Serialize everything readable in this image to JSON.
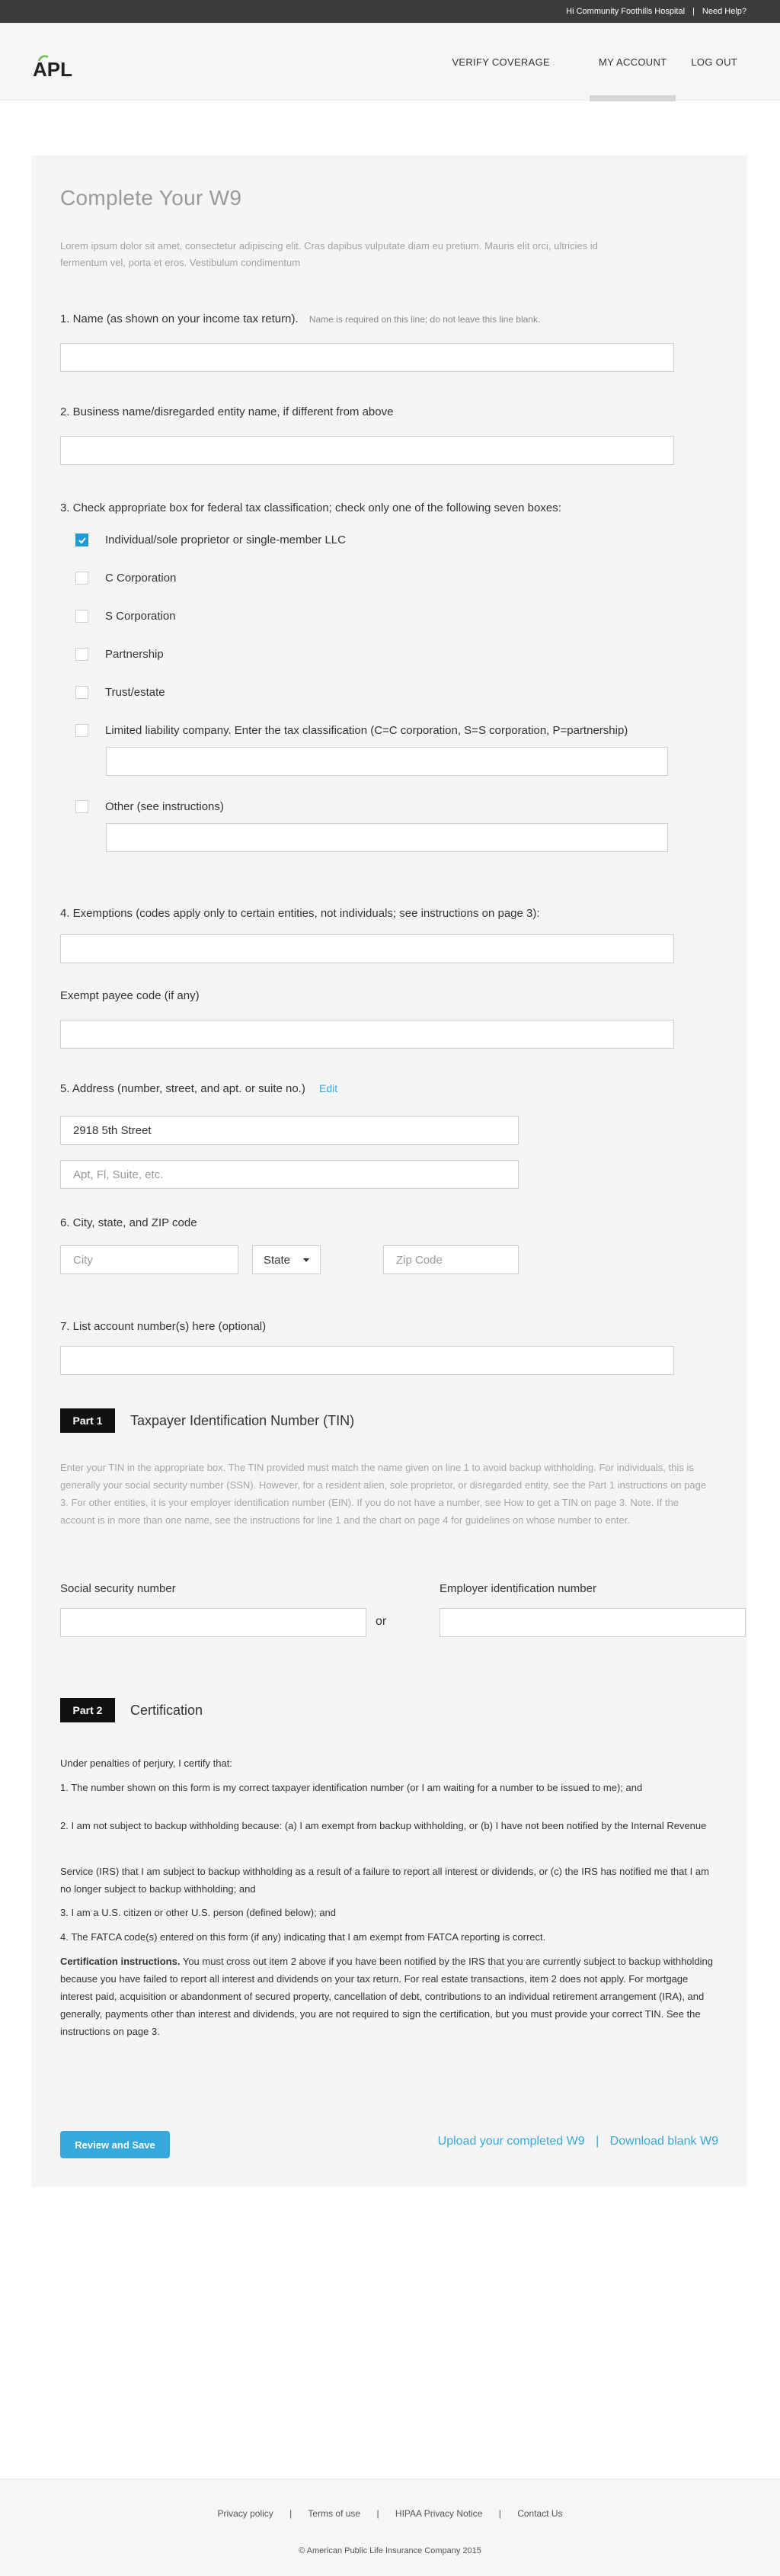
{
  "topbar": {
    "greeting": "Hi",
    "user_name": "Community Foothills Hospital",
    "separator": "|",
    "help_label": "Need Help?"
  },
  "header": {
    "logo_text": "APL",
    "nav": {
      "verify_coverage": "VERIFY COVERAGE",
      "my_account": "MY ACCOUNT",
      "log_out": "LOG OUT"
    }
  },
  "form": {
    "title": "Complete Your W9",
    "intro": "Lorem ipsum dolor sit amet, consectetur adipiscing elit. Cras dapibus vulputate diam eu pretium. Mauris elit orci, ultricies id fermentum vel, porta et eros. Vestibulum condimentum",
    "name": {
      "label": "1. Name (as shown on your income tax return).",
      "hint": "Name is required on this line; do not leave this line blank.",
      "value": ""
    },
    "business_name": {
      "label": "2. Business name/disregarded entity name, if different from above",
      "value": ""
    },
    "classification": {
      "label": "3. Check appropriate box for federal tax classification; check only one of the following seven boxes:",
      "options": [
        {
          "label": "Individual/sole proprietor or single-member LLC",
          "checked": true
        },
        {
          "label": "C Corporation",
          "checked": false
        },
        {
          "label": "S Corporation",
          "checked": false
        },
        {
          "label": "Partnership",
          "checked": false
        },
        {
          "label": "Trust/estate",
          "checked": false
        },
        {
          "label": "Limited liability company. Enter the tax classification (C=C corporation, S=S corporation, P=partnership)",
          "checked": false
        },
        {
          "label": "Other (see instructions)",
          "checked": false
        }
      ],
      "llc_value": "",
      "other_value": ""
    },
    "exemptions": {
      "label": "4. Exemptions (codes apply only to certain entities, not individuals; see instructions on page 3):",
      "value": ""
    },
    "exempt_payee": {
      "label": "Exempt payee code (if any)",
      "value": ""
    },
    "address": {
      "label": "5. Address (number, street, and apt. or suite no.)",
      "edit_label": "Edit",
      "street_value": "2918 5th Street",
      "apt_placeholder": "Apt, Fl, Suite, etc."
    },
    "city_state_zip": {
      "label": "6. City, state, and ZIP code",
      "city_placeholder": "City",
      "state_value": "State",
      "zip_placeholder": "Zip Code"
    },
    "account_numbers": {
      "label": "7. List account number(s) here (optional)",
      "value": ""
    },
    "part1": {
      "badge": "Part 1",
      "title": "Taxpayer Identification Number (TIN)",
      "text": "Enter your TIN in the appropriate box. The TIN provided must match the name given on line 1 to avoid backup withholding. For individuals, this is generally your social security number (SSN). However, for a resident alien, sole proprietor, or disregarded entity, see the Part 1 instructions on page 3. For other entities, it is your employer identification number (EIN). If you do not have a number, see How to get a TIN on page 3. Note. If the account is in more than one name, see the instructions for line 1 and the chart on page 4 for guidelines on whose number to enter.",
      "ssn_label": "Social security number",
      "or_label": "or",
      "ein_label": "Employer identification number"
    },
    "part2": {
      "badge": "Part 2",
      "title": "Certification",
      "lines": [
        "Under penalties of perjury, I certify that:",
        "1. The number shown on this form is my correct taxpayer identification number (or I am waiting for a number to be issued to me); and",
        "2. I am not subject to backup withholding because: (a) I am exempt from backup withholding, or (b) I have not been notified by the Internal Revenue",
        "Service (IRS) that I am subject to backup withholding as a result of a failure to report all interest or dividends, or (c) the IRS has notified me that I am no longer subject to backup withholding; and",
        "3. I am a U.S. citizen or other U.S. person (defined below); and",
        "4. The FATCA code(s) entered on this form (if any) indicating that I am exempt from FATCA reporting is correct."
      ],
      "instructions_heading": "Certification instructions.",
      "instructions_text": " You must cross out item 2 above if you have been notified by the IRS that you are currently subject to backup withholding because you have failed to report all interest and dividends on your tax return. For real estate transactions, item 2 does not apply. For mortgage interest paid, acquisition or abandonment of secured property, cancellation of debt, contributions to an individual retirement arrangement (IRA), and generally, payments other than interest and dividends, you are not required to sign the certification, but you must provide your correct TIN. See the instructions on page 3."
    },
    "actions": {
      "submit_label": "Review and Save",
      "upload_label": "Upload your completed W9",
      "separator": "|",
      "download_label": "Download blank W9"
    }
  },
  "footer": {
    "links": [
      "Privacy policy",
      "Terms of use",
      "HIPAA Privacy Notice",
      "Contact Us"
    ],
    "separator": "|",
    "copyright": "© American Public Life Insurance Company 2015"
  },
  "colors": {
    "accent": "#35a9dd",
    "checkbox_checked": "#1e9ad6",
    "topbar": "#3c3c3c",
    "badge": "#111111"
  }
}
